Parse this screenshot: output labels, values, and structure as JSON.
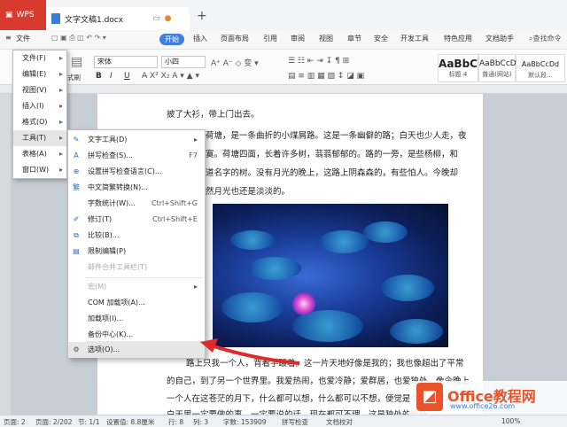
{
  "titlebar": {
    "app_tab": "WPS",
    "doc_tab": "文字文稿1.docx",
    "new_tab": "+"
  },
  "menubar": {
    "file_menu": "文件",
    "start_tab": "开始",
    "tabs": [
      "插入",
      "页面布局",
      "引用",
      "审阅",
      "视图",
      "章节",
      "安全",
      "开发工具",
      "特色应用",
      "文档助手"
    ],
    "search": "查找命令"
  },
  "ribbon": {
    "font_name": "宋体",
    "font_size": "小四",
    "format_painter": "式刷",
    "styles": [
      "AaBbC",
      "AaBbCcD",
      "AaBbCcDd"
    ],
    "style_names": [
      "标题 4",
      "普通(网站)",
      "默认段..."
    ]
  },
  "document": {
    "lines": [
      "披了大衫，带上门出去。",
      "荷塘，是一条曲折的小煤屑路。这是一条幽僻的路；白天也少人走，夜",
      "寞。荷塘四面，长着许多树，蓊蓊郁郁的。路的一旁，是些杨柳，和",
      "道名字的树。没有月光的晚上，这路上阴森森的，有些怕人。今晚却",
      "然月光也还是淡淡的。"
    ],
    "lines_below": [
      "路上只我一个人，背着手踱着。这一片天地好像是我的；我也像超出了平常",
      "的自己，到了另一个世界里。我爱热闹，也爱冷静；爱群居，也爱独处。像今晚上，",
      "一个人在这苍茫的月下，什么都可以想，什么都可以不想，便觉是个自由的人。",
      "白天里一定要做的事，一定要说的话，现在都可不理。这是独处的妙处"
    ]
  },
  "menu_level1": {
    "items": [
      {
        "label": "文件(F)"
      },
      {
        "label": "编辑(E)"
      },
      {
        "label": "视图(V)"
      },
      {
        "label": "插入(I)"
      },
      {
        "label": "格式(O)"
      },
      {
        "label": "工具(T)"
      },
      {
        "label": "表格(A)"
      },
      {
        "label": "窗口(W)"
      }
    ]
  },
  "menu_tools": {
    "items": [
      {
        "label": "文字工具(D)",
        "shortcut": ""
      },
      {
        "label": "拼写检查(S)...",
        "shortcut": "F7"
      },
      {
        "label": "设置拼写检查语言(C)...",
        "shortcut": ""
      },
      {
        "label": "中文简繁转换(N)...",
        "shortcut": ""
      },
      {
        "label": "字数统计(W)...",
        "shortcut": "Ctrl+Shift+G"
      },
      {
        "label": "修订(T)",
        "shortcut": "Ctrl+Shift+E"
      },
      {
        "label": "比较(B)...",
        "shortcut": ""
      },
      {
        "label": "限制编辑(P)",
        "shortcut": ""
      },
      {
        "label": "邮件合并工具栏(T)",
        "shortcut": ""
      },
      {
        "label": "宏(M)",
        "shortcut": ""
      },
      {
        "label": "COM 加载项(A)...",
        "shortcut": ""
      },
      {
        "label": "加载项(I)...",
        "shortcut": ""
      },
      {
        "label": "备份中心(K)...",
        "shortcut": ""
      },
      {
        "label": "选项(O)...",
        "shortcut": ""
      }
    ]
  },
  "statusbar": {
    "page": "页面: 2",
    "pages": "页面: 2/202",
    "section": "节: 1/1",
    "position": "设置值: 8.8厘米",
    "row": "行: 8",
    "col": "列: 3",
    "words": "字数: 153909",
    "spell": "拼写检查",
    "proof": "文档校对",
    "zoom": "100%"
  },
  "watermark": {
    "name": "Office教程网",
    "url": "www.office26.com"
  },
  "colors": {
    "wps_red": "#d93a2e",
    "accent_blue": "#3f7fe0",
    "arrow_red": "#e02a2a"
  }
}
